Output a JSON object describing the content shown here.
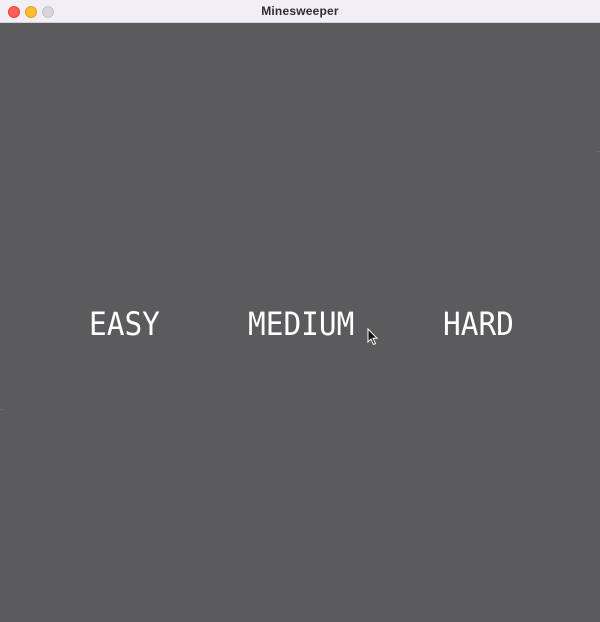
{
  "window": {
    "title": "Minesweeper"
  },
  "menu": {
    "levels": [
      {
        "id": "easy",
        "label": "EASY"
      },
      {
        "id": "medium",
        "label": "MEDIUM"
      },
      {
        "id": "hard",
        "label": "HARD"
      }
    ]
  },
  "colors": {
    "background": "#5b5a5d",
    "titlebar": "#f1eef4",
    "text": "#ffffff",
    "close": "#ff5f57",
    "minimize": "#febc2e",
    "zoom": "#d9d6dc"
  },
  "icons": {
    "close": "close-icon",
    "minimize": "minimize-icon",
    "zoom": "zoom-icon",
    "cursor": "mouse-pointer-icon"
  }
}
